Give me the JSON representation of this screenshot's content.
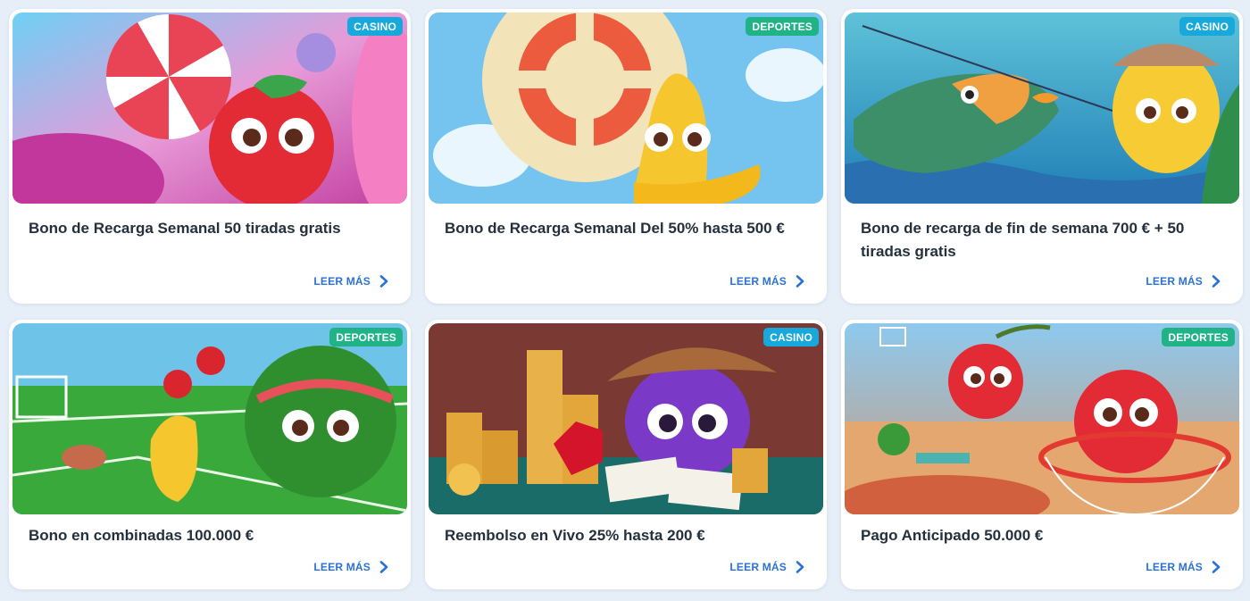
{
  "read_more_label": "LEER MÁS",
  "cards": [
    {
      "badge": "CASINO",
      "badge_type": "casino",
      "title": "Bono de Recarga Semanal 50 tiradas gratis",
      "image": "strawberry-candy-illustration"
    },
    {
      "badge": "DEPORTES",
      "badge_type": "deportes",
      "title": "Bono de Recarga Semanal Del 50% hasta 500 €",
      "image": "banana-parachute-illustration"
    },
    {
      "badge": "CASINO",
      "badge_type": "casino",
      "title": "Bono de recarga de fin de semana 700 € + 50 tiradas gratis",
      "image": "fishing-fruit-illustration"
    },
    {
      "badge": "DEPORTES",
      "badge_type": "deportes",
      "title": "Bono en combinadas 100.000 €",
      "image": "watermelon-football-illustration"
    },
    {
      "badge": "CASINO",
      "badge_type": "casino",
      "title": "Reembolso en Vivo 25% hasta 200 €",
      "image": "cowboy-coins-illustration"
    },
    {
      "badge": "DEPORTES",
      "badge_type": "deportes",
      "title": "Pago Anticipado 50.000 €",
      "image": "cherries-basketball-illustration"
    }
  ],
  "colors": {
    "page_background": "#e6eef8",
    "casino_badge": "#17a9dc",
    "deportes_badge": "#1fb386",
    "link": "#2a72d6",
    "title_text": "#24303e"
  }
}
